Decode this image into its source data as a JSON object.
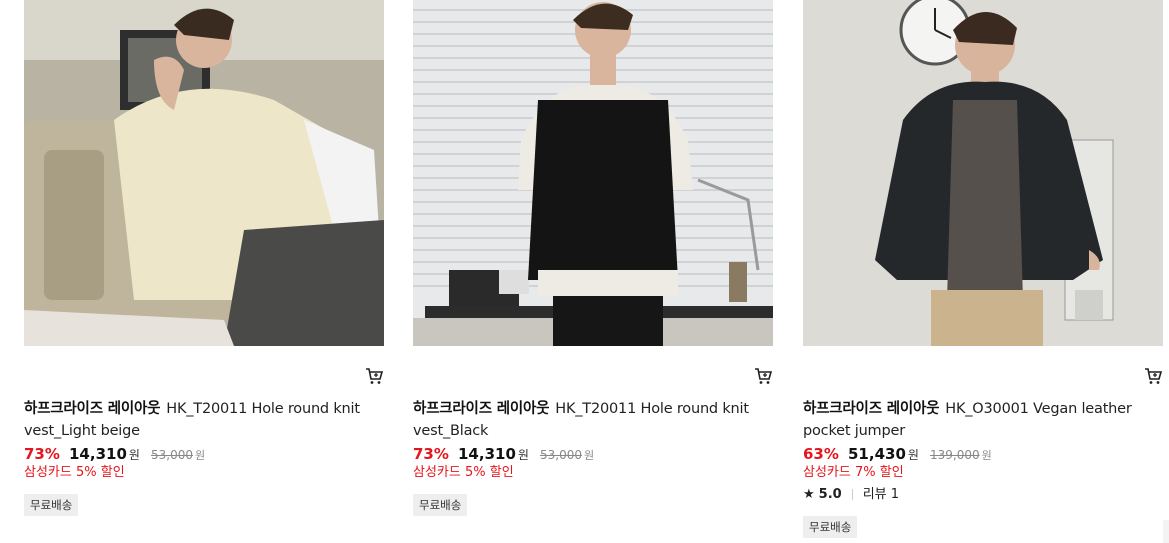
{
  "products": [
    {
      "brand": "하프크라이즈 레이아웃",
      "name": "HK_T20011 Hole round knit vest_Light beige",
      "discount": "73%",
      "price": "14,310",
      "currency": "원",
      "original_price": "53,000",
      "card_promo": "삼성카드 5% 할인",
      "shipping_badge": "무료배송",
      "image_icon": "model-photo-beige-knit-vest"
    },
    {
      "brand": "하프크라이즈 레이아웃",
      "name": "HK_T20011 Hole round knit vest_Black",
      "discount": "73%",
      "price": "14,310",
      "currency": "원",
      "original_price": "53,000",
      "card_promo": "삼성카드 5% 할인",
      "shipping_badge": "무료배송",
      "image_icon": "model-photo-black-knit-vest"
    },
    {
      "brand": "하프크라이즈 레이아웃",
      "name": "HK_O30001 Vegan leather pocket jumper",
      "discount": "63%",
      "price": "51,430",
      "currency": "원",
      "original_price": "139,000",
      "card_promo": "삼성카드 7% 할인",
      "rating_score": "5.0",
      "review_label": "리뷰 1",
      "shipping_badge": "무료배송",
      "image_icon": "model-photo-leather-jumper"
    }
  ],
  "icons": {
    "cart": "cart-icon",
    "star": "star-icon"
  },
  "colors": {
    "discount": "#e4161c",
    "badge_bg": "#eeeeee"
  }
}
